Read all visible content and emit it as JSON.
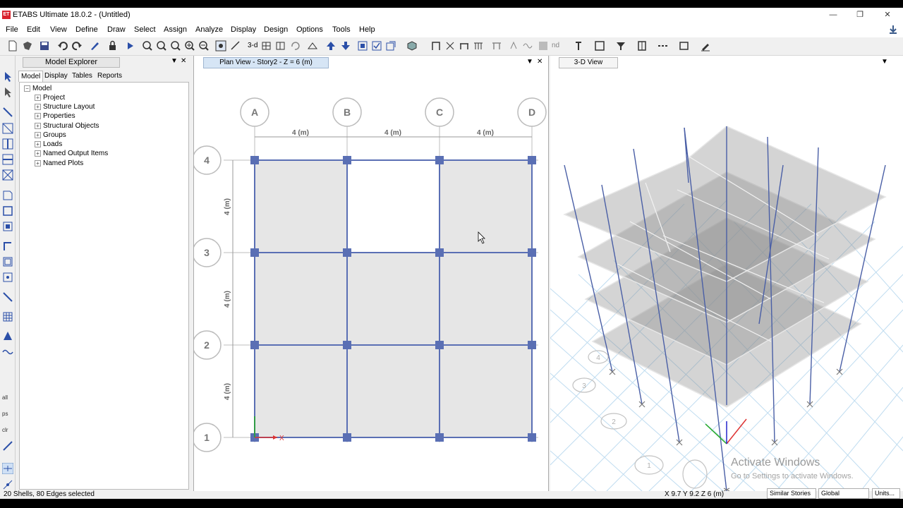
{
  "window": {
    "title": "ETABS Ultimate 18.0.2 - (Untitled)",
    "logo": "ET",
    "minimize": "—",
    "restore": "❐",
    "close": "✕"
  },
  "menu": [
    "File",
    "Edit",
    "View",
    "Define",
    "Draw",
    "Select",
    "Assign",
    "Analyze",
    "Display",
    "Design",
    "Options",
    "Tools",
    "Help"
  ],
  "toolbar_text": {
    "three_d": "3-d",
    "nd": "nd"
  },
  "explorer": {
    "title": "Model Explorer",
    "tabs": [
      "Model",
      "Display",
      "Tables",
      "Reports"
    ],
    "active_tab": "Model",
    "root": "Model",
    "items": [
      "Project",
      "Structure Layout",
      "Properties",
      "Structural Objects",
      "Groups",
      "Loads",
      "Named Output Items",
      "Named Plots"
    ]
  },
  "plan_view": {
    "tab_label": "Plan View - Story2 - Z = 6 (m)",
    "grid_x": [
      "A",
      "B",
      "C",
      "D"
    ],
    "grid_y": [
      "4",
      "3",
      "2",
      "1"
    ],
    "spacing_label": "4 (m)",
    "empty_bay": "row 4-3, bay B-C",
    "axis_x": "X",
    "axis_y": "Y"
  },
  "threed_view": {
    "tab_label": "3-D View",
    "stories_shown": 4,
    "bubble_labels": [
      "4",
      "3",
      "2",
      "1"
    ]
  },
  "status": {
    "selection": "20 Shells, 80 Edges selected",
    "coords": "X 9.7  Y 9.2  Z 6 (m)",
    "stories": "Similar Stories",
    "coord_system": "Global",
    "units": "Units..."
  },
  "watermark": {
    "line1": "Activate Windows",
    "line2": "Go to Settings to activate Windows."
  },
  "colors": {
    "accent": "#2b4fa8",
    "node": "#5a6fb4",
    "shell": "#e6e6e6",
    "tab_active": "#d6e5f5"
  }
}
